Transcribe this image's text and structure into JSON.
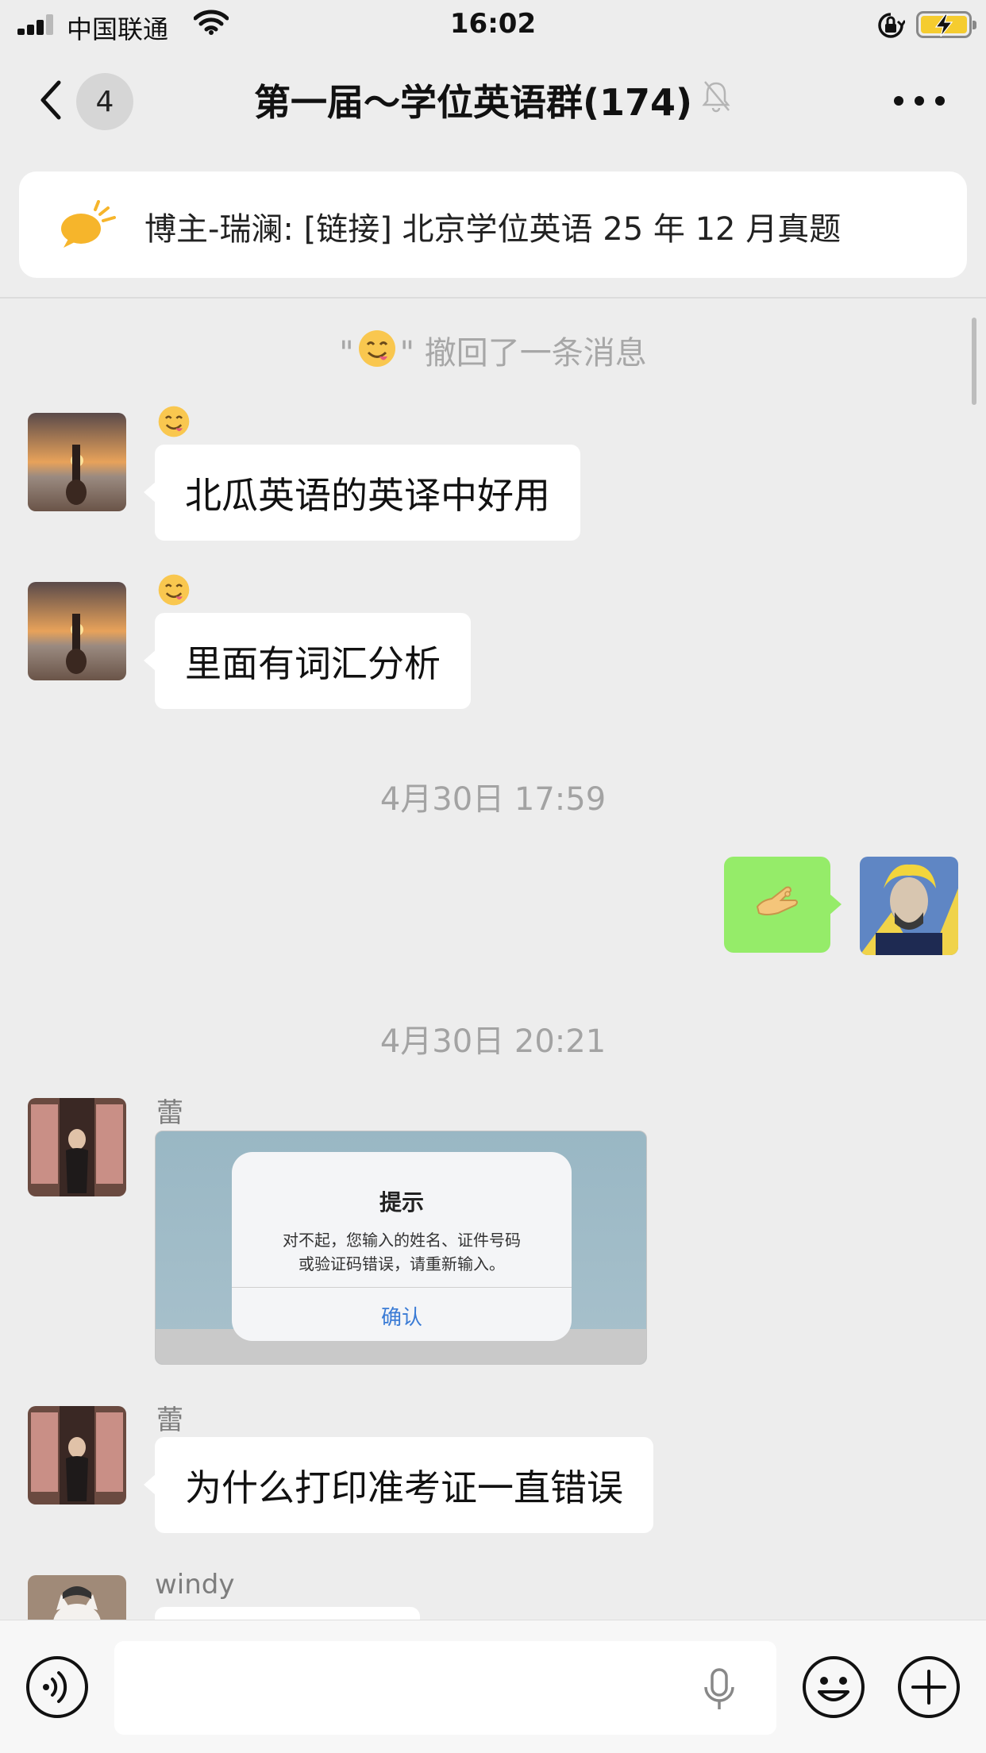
{
  "status_bar": {
    "carrier": "中国联通",
    "time": "16:02"
  },
  "nav": {
    "back_badge": "4",
    "title": "第一届～学位英语群(174)"
  },
  "pinned_notice": {
    "text": "博主-瑞澜: [链接] 北京学位英语 25 年 12 月真题"
  },
  "messages": {
    "recalled": {
      "quote_open": "\"",
      "quote_close": "\"",
      "text": "撤回了一条消息"
    },
    "msg1": {
      "text": "北瓜英语的英译中好用"
    },
    "msg2": {
      "text": "里面有词汇分析"
    },
    "timestamp1": "4月30日 17:59",
    "timestamp2": "4月30日 20:21",
    "img_msg": {
      "sender": "蕾",
      "dialog_title": "提示",
      "dialog_line1": "对不起，您输入的姓名、证件号码",
      "dialog_line2": "或验证码错误，请重新输入。",
      "dialog_button": "确认"
    },
    "msg3": {
      "sender": "蕾",
      "text": "为什么打印准考证一直错误"
    },
    "msg4": {
      "sender": "windy"
    }
  },
  "icons": {
    "back": "chevron-left-icon",
    "mute": "bell-slash-icon",
    "more": "more-icon",
    "pinned": "speech-bubble-icon",
    "voice": "voice-icon",
    "mic": "microphone-icon",
    "emoji": "emoji-icon",
    "plus": "plus-icon"
  },
  "colors": {
    "background": "#ededed",
    "own_bubble": "#95ec69",
    "other_bubble": "#ffffff",
    "battery": "#f5cc2f"
  }
}
